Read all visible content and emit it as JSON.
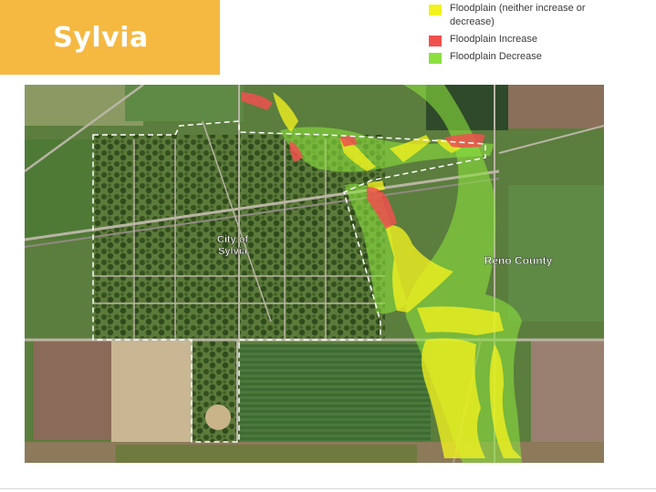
{
  "title": "Sylvia",
  "colors": {
    "title_bg": "#f5b942",
    "neither": "#f2f21f",
    "increase": "#f0504e",
    "decrease": "#8be03e"
  },
  "legend": {
    "items": [
      {
        "key": "neither",
        "label": "Floodplain (neither increase or decrease)",
        "color": "#f2f21f"
      },
      {
        "key": "increase",
        "label": "Floodplain Increase",
        "color": "#f0504e"
      },
      {
        "key": "decrease",
        "label": "Floodplain Decrease",
        "color": "#8be03e"
      }
    ]
  },
  "map": {
    "labels": {
      "city": [
        "City of",
        "Sylvia"
      ],
      "county": "Reno County"
    }
  }
}
